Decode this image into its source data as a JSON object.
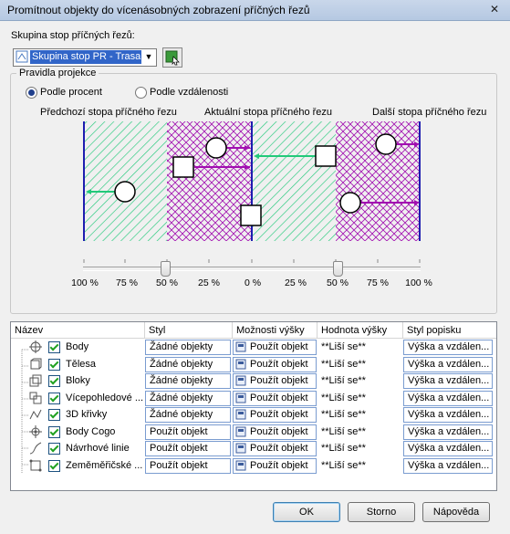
{
  "window": {
    "title": "Promítnout objekty do vícenásobných zobrazení příčných řezů",
    "close_glyph": "✕"
  },
  "group_label": "Skupina stop příčných řezů:",
  "group_combo": {
    "value": "Skupina stop PR - Trasa - (",
    "arrow": "▼"
  },
  "rules": {
    "label": "Pravidla projekce",
    "option_percent": "Podle procent",
    "option_distance": "Podle vzdálenosti",
    "selected": "percent"
  },
  "preview": {
    "label_prev": "Předchozí stopa příčného řezu",
    "label_current": "Aktuální stopa příčného řezu",
    "label_next": "Další stopa příčného řezu",
    "ticks": [
      "100 %",
      "75 %",
      "50 %",
      "25 %",
      "0 %",
      "25 %",
      "50 %",
      "75 %",
      "100 %"
    ],
    "slider_left_value": "50 %",
    "slider_right_value": "50 %",
    "colors": {
      "green": "#22c97a",
      "purple": "#a10fb0",
      "axis": "#1d1db0"
    }
  },
  "table": {
    "headers": [
      "Název",
      "Styl",
      "Možnosti výšky",
      "Hodnota výšky",
      "Styl popisku"
    ],
    "rows": [
      {
        "icon": "point-icon",
        "name": "Body",
        "style": "Žádné objekty",
        "height_option": "Použít objekt",
        "height_value": "**Liší se**",
        "label_style": "Výška a vzdálen..."
      },
      {
        "icon": "solid-icon",
        "name": "Tělesa",
        "style": "Žádné objekty",
        "height_option": "Použít objekt",
        "height_value": "**Liší se**",
        "label_style": "Výška a vzdálen..."
      },
      {
        "icon": "block-icon",
        "name": "Bloky",
        "style": "Žádné objekty",
        "height_option": "Použít objekt",
        "height_value": "**Liší se**",
        "label_style": "Výška a vzdálen..."
      },
      {
        "icon": "multiview-block-icon",
        "name": "Vícepohledové ...",
        "style": "Žádné objekty",
        "height_option": "Použít objekt",
        "height_value": "**Liší se**",
        "label_style": "Výška a vzdálen..."
      },
      {
        "icon": "3d-polyline-icon",
        "name": "3D křivky",
        "style": "Žádné objekty",
        "height_option": "Použít objekt",
        "height_value": "**Liší se**",
        "label_style": "Výška a vzdálen..."
      },
      {
        "icon": "cogo-point-icon",
        "name": "Body Cogo",
        "style": "Použít objekt",
        "height_option": "Použít objekt",
        "height_value": "**Liší se**",
        "label_style": "Výška a vzdálen..."
      },
      {
        "icon": "feature-line-icon",
        "name": "Návrhové linie",
        "style": "Použít objekt",
        "height_option": "Použít objekt",
        "height_value": "**Liší se**",
        "label_style": "Výška a vzdálen..."
      },
      {
        "icon": "survey-figure-icon",
        "name": "Zeměměřičské ...",
        "style": "Použít objekt",
        "height_option": "Použít objekt",
        "height_value": "**Liší se**",
        "label_style": "Výška a vzdálen..."
      }
    ]
  },
  "buttons": {
    "ok": "OK",
    "cancel": "Storno",
    "help": "Nápověda"
  }
}
